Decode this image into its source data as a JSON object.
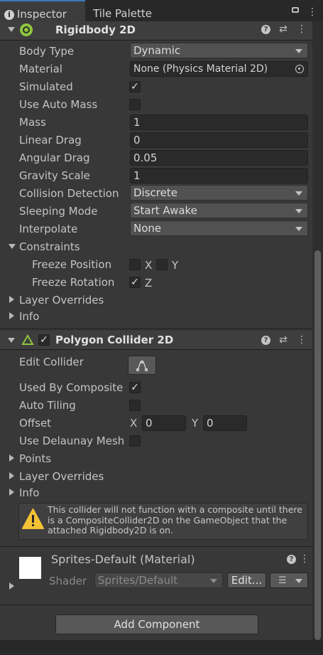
{
  "tabs": {
    "inspector": "Inspector",
    "tile_palette": "Tile Palette"
  },
  "rigidbody": {
    "title": "Rigidbody 2D",
    "body_type_label": "Body Type",
    "body_type_value": "Dynamic",
    "material_label": "Material",
    "material_value": "None (Physics Material 2D)",
    "simulated_label": "Simulated",
    "simulated": true,
    "use_auto_mass_label": "Use Auto Mass",
    "use_auto_mass": false,
    "mass_label": "Mass",
    "mass_value": "1",
    "linear_drag_label": "Linear Drag",
    "linear_drag_value": "0",
    "angular_drag_label": "Angular Drag",
    "angular_drag_value": "0.05",
    "gravity_scale_label": "Gravity Scale",
    "gravity_scale_value": "1",
    "collision_detection_label": "Collision Detection",
    "collision_detection_value": "Discrete",
    "sleeping_mode_label": "Sleeping Mode",
    "sleeping_mode_value": "Start Awake",
    "interpolate_label": "Interpolate",
    "interpolate_value": "None",
    "constraints_label": "Constraints",
    "freeze_position_label": "Freeze Position",
    "freeze_position_x": false,
    "freeze_position_y": false,
    "freeze_rotation_label": "Freeze Rotation",
    "freeze_rotation_z": true,
    "x_label": "X",
    "y_label": "Y",
    "z_label": "Z",
    "layer_overrides_label": "Layer Overrides",
    "info_label": "Info"
  },
  "polygon_collider": {
    "title": "Polygon Collider 2D",
    "enabled": true,
    "edit_collider_label": "Edit Collider",
    "used_by_composite_label": "Used By Composite",
    "used_by_composite": true,
    "auto_tiling_label": "Auto Tiling",
    "auto_tiling": false,
    "offset_label": "Offset",
    "offset_x_label": "X",
    "offset_x": "0",
    "offset_y_label": "Y",
    "offset_y": "0",
    "use_delaunay_label": "Use Delaunay Mesh",
    "use_delaunay": false,
    "points_label": "Points",
    "layer_overrides_label": "Layer Overrides",
    "info_label": "Info",
    "warning": "This collider will not function with a composite until there is a CompositeCollider2D on the GameObject that the attached Rigidbody2D is on."
  },
  "material": {
    "title": "Sprites-Default (Material)",
    "shader_label": "Shader",
    "shader_value": "Sprites/Default",
    "edit_label": "Edit..."
  },
  "add_component_label": "Add Component",
  "icons": [
    "info-icon",
    "lock-icon",
    "more-icon",
    "rigidbody-icon",
    "polygon-collider-icon",
    "help-icon",
    "preset-icon",
    "warning-icon",
    "target-icon",
    "edit-collider-icon",
    "list-icon"
  ],
  "colors": {
    "background": "#383838",
    "header": "#3e3e3e",
    "field": "#2a2a2a",
    "dropdown": "#515151",
    "warning": "#f4c235",
    "accent": "#3a79bb"
  }
}
